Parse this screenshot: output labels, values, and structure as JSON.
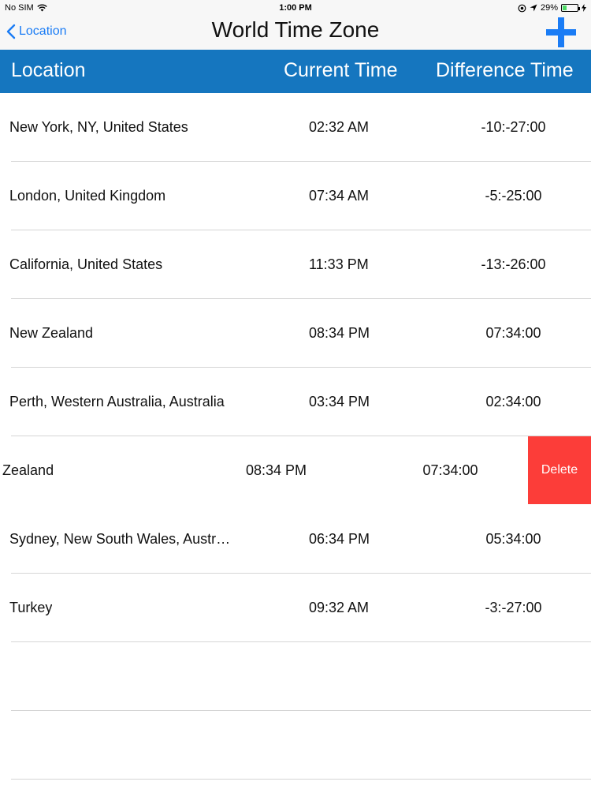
{
  "status_bar": {
    "carrier": "No SIM",
    "time": "1:00 PM",
    "battery": "29%",
    "battery_level": 0.29
  },
  "nav": {
    "back_label": "Location",
    "title": "World Time Zone",
    "add_icon": "plus-icon",
    "accent_color": "#1a7cf5"
  },
  "table": {
    "header_color": "#1576bf",
    "columns": [
      "Location",
      "Current Time",
      "Difference Time"
    ],
    "rows": [
      {
        "location": "New York, NY, United States",
        "current_time": "02:32 AM",
        "difference": "-10:-27:00"
      },
      {
        "location": "London, United Kingdom",
        "current_time": "07:34 AM",
        "difference": "-5:-25:00"
      },
      {
        "location": "California, United States",
        "current_time": "11:33 PM",
        "difference": "-13:-26:00"
      },
      {
        "location": "New Zealand",
        "current_time": "08:34 PM",
        "difference": "07:34:00"
      },
      {
        "location": "Perth, Western Australia, Australia",
        "current_time": "03:34 PM",
        "difference": "02:34:00"
      },
      {
        "location": "nd, New Zealand",
        "current_time": "08:34 PM",
        "difference": "07:34:00",
        "swiped": true,
        "delete_label": "Delete"
      },
      {
        "location": "Sydney, New South Wales, Austr…",
        "current_time": "06:34 PM",
        "difference": "05:34:00"
      },
      {
        "location": "Turkey",
        "current_time": "09:32 AM",
        "difference": "-3:-27:00"
      }
    ],
    "empty_rows": 2
  }
}
